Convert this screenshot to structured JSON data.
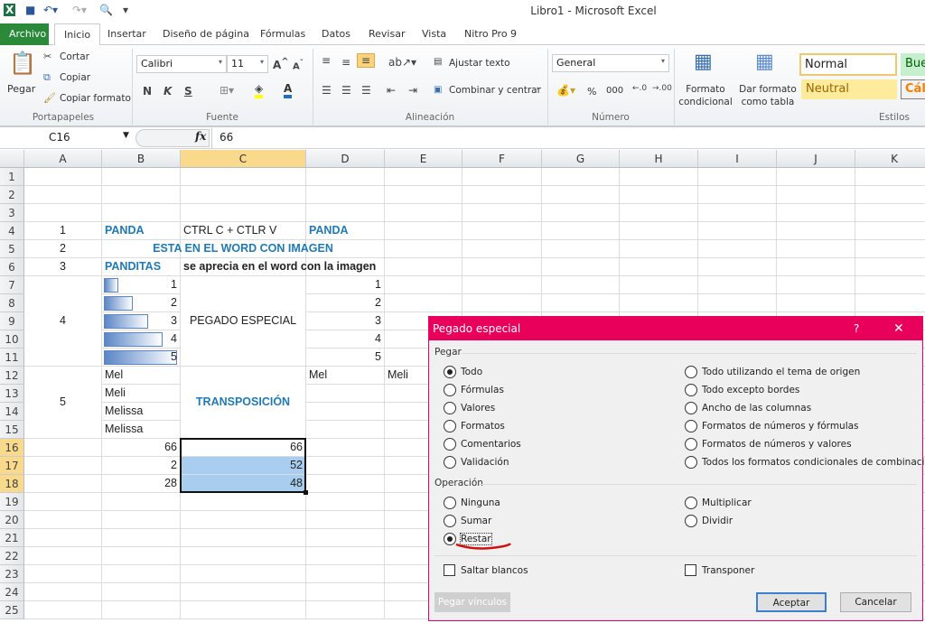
{
  "window": {
    "title": "Libro1  -  Microsoft Excel"
  },
  "quick_access": {
    "icons": [
      "excel-logo",
      "save-icon",
      "undo-icon",
      "redo-icon",
      "print-preview-icon",
      "customize-icon"
    ]
  },
  "tabs": [
    "Archivo",
    "Inicio",
    "Insertar",
    "Diseño de página",
    "Fórmulas",
    "Datos",
    "Revisar",
    "Vista",
    "Nitro Pro 9"
  ],
  "active_tab": "Inicio",
  "ribbon": {
    "clipboard": {
      "paste": "Pegar",
      "cut": "Cortar",
      "copy": "Copiar",
      "format_painter": "Copiar formato",
      "label": "Portapapeles"
    },
    "font": {
      "name": "Calibri",
      "size": "11",
      "bold": "N",
      "italic": "K",
      "underline": "S",
      "label": "Fuente",
      "fill_color": "#ffff00",
      "font_color": "#1f6fbf"
    },
    "alignment": {
      "wrap": "Ajustar texto",
      "merge": "Combinar y centrar",
      "label": "Alineación"
    },
    "number": {
      "format": "General",
      "percent": "%",
      "thousands": "000",
      "label": "Número"
    },
    "styles": {
      "conditional": "Formato condicional",
      "table": "Dar formato como tabla",
      "normal": "Normal",
      "good": "Bue",
      "neutral": "Neutral",
      "calc": "Cálc",
      "label": "Estilos"
    }
  },
  "formula_bar": {
    "name_box": "C16",
    "fx": "fx",
    "value": "66"
  },
  "sheet": {
    "columns": [
      "A",
      "B",
      "C",
      "D",
      "E",
      "F",
      "G",
      "H",
      "I",
      "J",
      "K"
    ],
    "selected_column": "C",
    "rows": 25,
    "selected_rows": [
      16,
      17,
      18
    ],
    "cells": [
      {
        "ref": "A4",
        "v": "1",
        "s": "center"
      },
      {
        "ref": "B4",
        "v": "PANDA",
        "s": "blue"
      },
      {
        "ref": "C4",
        "v": "CTRL C + CTLR V",
        "s": ""
      },
      {
        "ref": "D4",
        "v": "PANDA",
        "s": "blue"
      },
      {
        "ref": "A5",
        "v": "2",
        "s": "center"
      },
      {
        "ref": "B5:D5",
        "v": "ESTA EN EL WORD CON IMAGEN",
        "s": "blue center"
      },
      {
        "ref": "A6",
        "v": "3",
        "s": "center"
      },
      {
        "ref": "B6",
        "v": "PANDITAS",
        "s": "blue"
      },
      {
        "ref": "C6",
        "v": "se aprecia en el word con la imagen",
        "s": "bold"
      },
      {
        "ref": "B7",
        "v": "1",
        "s": "right",
        "bar": 0.2
      },
      {
        "ref": "B8",
        "v": "2",
        "s": "right",
        "bar": 0.4
      },
      {
        "ref": "B9",
        "v": "3",
        "s": "right",
        "bar": 0.6
      },
      {
        "ref": "B10",
        "v": "4",
        "s": "right",
        "bar": 0.8
      },
      {
        "ref": "B11",
        "v": "5",
        "s": "right",
        "bar": 1.0
      },
      {
        "ref": "A7:A11",
        "v": "4",
        "s": "center fill"
      },
      {
        "ref": "C7:C11",
        "v": "PEGADO ESPECIAL",
        "s": "center fill"
      },
      {
        "ref": "D7",
        "v": "1",
        "s": "right"
      },
      {
        "ref": "D8",
        "v": "2",
        "s": "right"
      },
      {
        "ref": "D9",
        "v": "3",
        "s": "right"
      },
      {
        "ref": "D10",
        "v": "4",
        "s": "right"
      },
      {
        "ref": "D11",
        "v": "5",
        "s": "right"
      },
      {
        "ref": "B12",
        "v": "Mel",
        "s": ""
      },
      {
        "ref": "D12",
        "v": "Mel",
        "s": ""
      },
      {
        "ref": "E12",
        "v": "Meli",
        "s": ""
      },
      {
        "ref": "B13",
        "v": "Meli",
        "s": ""
      },
      {
        "ref": "B14",
        "v": "Melissa",
        "s": ""
      },
      {
        "ref": "B15",
        "v": "Melissa",
        "s": ""
      },
      {
        "ref": "A12:A15",
        "v": "5",
        "s": "center fill"
      },
      {
        "ref": "C12:C15",
        "v": "TRANSPOSICIÓN",
        "s": "blue center fill"
      },
      {
        "ref": "B16",
        "v": "66",
        "s": "right"
      },
      {
        "ref": "C16",
        "v": "66",
        "s": "right"
      },
      {
        "ref": "B17",
        "v": "2",
        "s": "right"
      },
      {
        "ref": "C17",
        "v": "52",
        "s": "right selfill"
      },
      {
        "ref": "B18",
        "v": "28",
        "s": "right"
      },
      {
        "ref": "C18",
        "v": "48",
        "s": "right selfill"
      }
    ]
  },
  "dialog": {
    "title": "Pegado especial",
    "help": "?",
    "close": "✕",
    "title_color": "#e8005a",
    "paste_label": "Pegar",
    "paste_left": [
      {
        "label": "Todo",
        "checked": true
      },
      {
        "label": "Fórmulas"
      },
      {
        "label": "Valores"
      },
      {
        "label": "Formatos"
      },
      {
        "label": "Comentarios"
      },
      {
        "label": "Validación"
      }
    ],
    "paste_right": [
      {
        "label": "Todo utilizando el tema de origen"
      },
      {
        "label": "Todo excepto bordes"
      },
      {
        "label": "Ancho de las columnas"
      },
      {
        "label": "Formatos de números y fórmulas"
      },
      {
        "label": "Formatos de números y valores"
      },
      {
        "label": "Todos los formatos condicionales de combinación"
      }
    ],
    "operation_label": "Operación",
    "op_left": [
      {
        "label": "Ninguna"
      },
      {
        "label": "Sumar"
      },
      {
        "label": "Restar",
        "checked": true
      }
    ],
    "op_right": [
      {
        "label": "Multiplicar"
      },
      {
        "label": "Dividir"
      }
    ],
    "skip_blanks": "Saltar blancos",
    "transpose": "Transponer",
    "paste_links": "Pegar vínculos",
    "ok": "Aceptar",
    "cancel": "Cancelar"
  }
}
